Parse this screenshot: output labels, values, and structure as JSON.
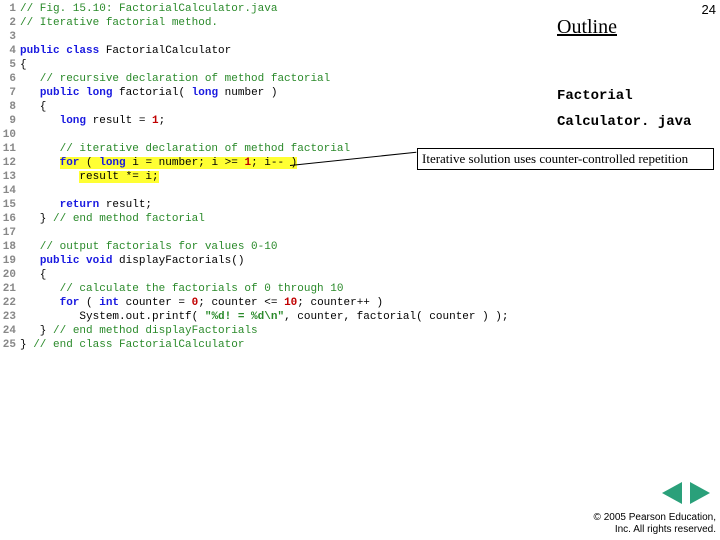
{
  "slide_number": "24",
  "outline_title": "Outline",
  "file_label_1": "Factorial",
  "file_label_2": "Calculator. java",
  "callout": "Iterative solution uses counter-controlled repetition",
  "copyright_line1": "© 2005 Pearson Education,",
  "copyright_line2": "Inc.  All rights reserved.",
  "code": {
    "l1": {
      "n": "1",
      "comment": "// Fig. 15.10: FactorialCalculator.java"
    },
    "l2": {
      "n": "2",
      "comment": "// Iterative factorial method."
    },
    "l3": {
      "n": "3"
    },
    "l4": {
      "n": "4",
      "kw1": "public class ",
      "id": "FactorialCalculator"
    },
    "l5": {
      "n": "5",
      "brace": "{"
    },
    "l6": {
      "n": "6",
      "comment": "   // recursive declaration of method factorial"
    },
    "l7": {
      "n": "7",
      "pre": "   ",
      "kw1": "public long ",
      "id": "factorial( ",
      "kw2": "long ",
      "id2": "number )"
    },
    "l8": {
      "n": "8",
      "brace": "   {"
    },
    "l9": {
      "n": "9",
      "pre": "      ",
      "kw1": "long ",
      "id": "result = ",
      "num": "1",
      "post": ";"
    },
    "l10": {
      "n": "10"
    },
    "l11": {
      "n": "11",
      "comment": "      // iterative declaration of method factorial"
    },
    "l12": {
      "n": "12",
      "pre": "      ",
      "hl_kw": "for",
      "hl_a": " ( ",
      "hl_kw2": "long",
      "hl_b": " i = number; i >= ",
      "hl_num": "1",
      "hl_c": "; i-- )"
    },
    "l13": {
      "n": "13",
      "pre": "         ",
      "hl_a": "result *= i;"
    },
    "l14": {
      "n": "14"
    },
    "l15": {
      "n": "15",
      "pre": "      ",
      "kw1": "return ",
      "id": "result;"
    },
    "l16": {
      "n": "16",
      "brace": "   } ",
      "comment": "// end method factorial"
    },
    "l17": {
      "n": "17"
    },
    "l18": {
      "n": "18",
      "comment": "   // output factorials for values 0-10"
    },
    "l19": {
      "n": "19",
      "pre": "   ",
      "kw1": "public void ",
      "id": "displayFactorials()"
    },
    "l20": {
      "n": "20",
      "brace": "   {"
    },
    "l21": {
      "n": "21",
      "comment": "      // calculate the factorials of 0 through 10"
    },
    "l22": {
      "n": "22",
      "pre": "      ",
      "kw1": "for ",
      "id": "( ",
      "kw2": "int ",
      "id2": "counter = ",
      "num": "0",
      "id3": "; counter <= ",
      "num2": "10",
      "id4": "; counter++ )"
    },
    "l23": {
      "n": "23",
      "pre": "         ",
      "id": "System.out.printf( ",
      "str": "\"%d! = %d\\n\"",
      "id2": ", counter, factorial( counter ) );"
    },
    "l24": {
      "n": "24",
      "brace": "   } ",
      "comment": "// end method displayFactorials"
    },
    "l25": {
      "n": "25",
      "brace": "} ",
      "comment": "// end class FactorialCalculator"
    }
  }
}
